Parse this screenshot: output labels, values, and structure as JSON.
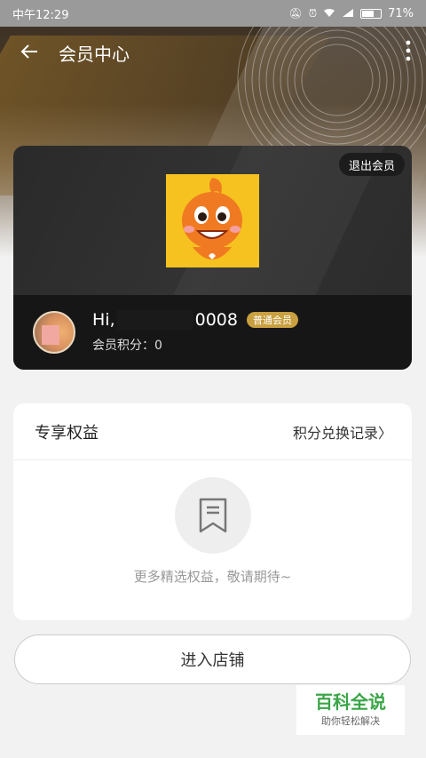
{
  "status": {
    "time": "中午12:29",
    "battery": "71%",
    "battery_level": 0.71
  },
  "header": {
    "title": "会员中心"
  },
  "card": {
    "logout_label": "退出会员",
    "greeting": "Hi,",
    "phone_suffix": "0008",
    "member_level": "普通会员",
    "points": "会员积分：0"
  },
  "benefits": {
    "title": "专享权益",
    "points_link": "积分兑换记录",
    "empty_text": "更多精选权益，敬请期待~"
  },
  "actions": {
    "enter_store": "进入店铺"
  },
  "watermark": {
    "brand": "百科全说",
    "slogan": "助你轻松解决"
  },
  "colors": {
    "badge": "#c9a040",
    "watermark_green": "#3aa547"
  }
}
